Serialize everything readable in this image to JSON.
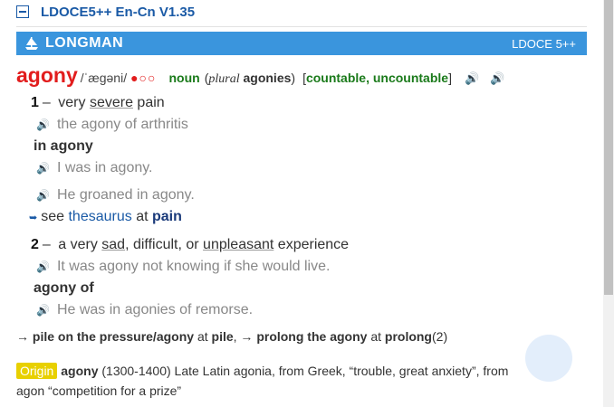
{
  "dict": {
    "title": "LDOCE5++ En-Cn V1.35",
    "brand": "LONGMAN",
    "edition": "LDOCE 5++"
  },
  "headword": {
    "word": "agony",
    "pron": "/ˈæɡəni/",
    "freq": "●○○",
    "pos": "noun",
    "plural_label": "plural",
    "plural_form": "agonies",
    "grammar": "countable, uncountable"
  },
  "senses": [
    {
      "num": "1",
      "def_parts": [
        "very ",
        "severe",
        " pain"
      ],
      "examples": [
        "the agony of arthritis"
      ],
      "collocations": [
        {
          "phrase": "in agony",
          "examples": [
            "I was in agony.",
            "He groaned in agony."
          ]
        }
      ],
      "thesaurus": {
        "see": "see",
        "link": "thesaurus",
        "at": "at",
        "target": "pain"
      }
    },
    {
      "num": "2",
      "def_parts": [
        "a very ",
        "sad",
        ", difficult, or ",
        "unpleasant",
        " experience"
      ],
      "examples": [
        "It was agony not knowing if she would live."
      ],
      "collocations": [
        {
          "phrase": "agony of",
          "examples": [
            "He was in agonies of remorse."
          ]
        }
      ]
    }
  ],
  "xrefs": {
    "arrow1": "→",
    "phrase1": "pile on the pressure/agony",
    "at1": "at",
    "target1": "pile",
    "sep": ",",
    "arrow2": "→",
    "phrase2": "prolong the agony",
    "at2": "at",
    "target2": "prolong",
    "sub2": "(2)"
  },
  "origin": {
    "label": "Origin",
    "word": "agony",
    "text1": "(1300-1400) Late Latin agonia, from Greek, “trouble, great anxiety”, from",
    "text2": "agon “competition for a prize”"
  },
  "icons": {
    "speaker_red": "speaker-red-icon",
    "speaker_blue": "speaker-blue-icon",
    "speaker_gray": "speaker-gray-icon"
  },
  "colors": {
    "headword": "#e21d1d",
    "banner": "#3a95dd",
    "pos": "#1a7a1a",
    "link": "#1a5aa6",
    "origin_badge": "#e8d000"
  }
}
